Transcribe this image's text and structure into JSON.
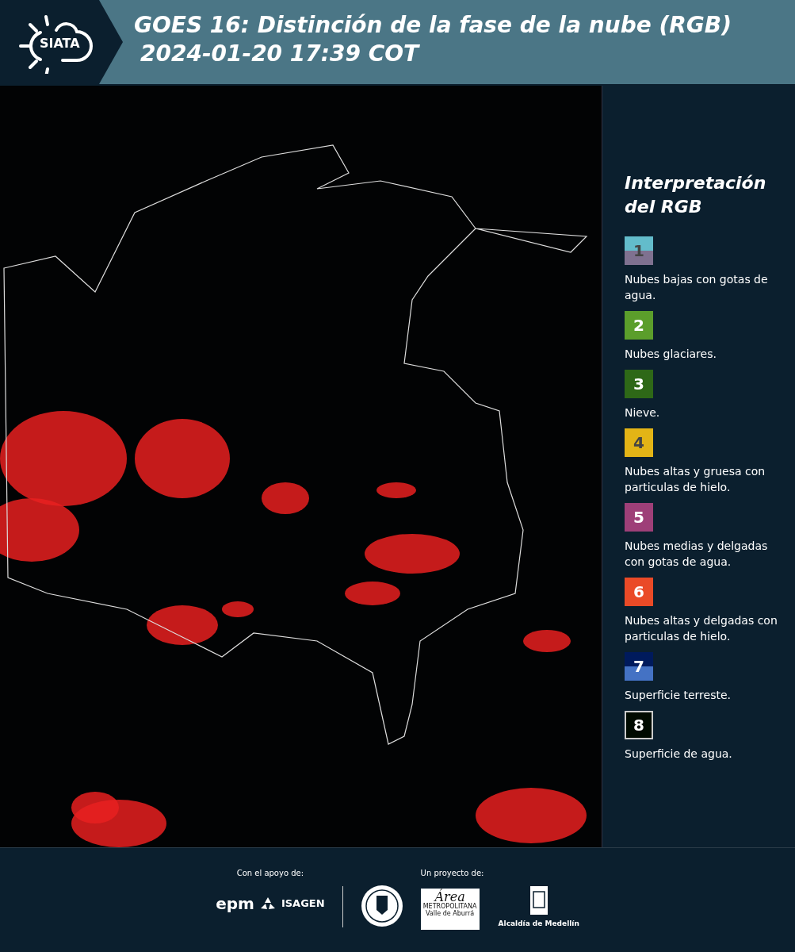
{
  "header": {
    "logo_text": "SIATA",
    "title": "GOES 16: Distinción de la fase de la nube (RGB)",
    "subtitle": "2024-01-20 17:39 COT"
  },
  "legend": {
    "title": "Interpretación del RGB",
    "items": [
      {
        "number": "1",
        "bands": [
          {
            "color": "#63bccb"
          },
          {
            "color": "#7f7190"
          }
        ],
        "label": "Nubes bajas con gotas de agua."
      },
      {
        "number": "2",
        "bands": [
          {
            "color": "#5b9e2b"
          }
        ],
        "label": "Nubes glaciares."
      },
      {
        "number": "3",
        "bands": [
          {
            "color": "#2e6817"
          }
        ],
        "label": "Nieve."
      },
      {
        "number": "4",
        "bands": [
          {
            "color": "#e3b416"
          }
        ],
        "label": "Nubes altas y gruesa con particulas de hielo."
      },
      {
        "number": "5",
        "bands": [
          {
            "color": "#9e3f78"
          }
        ],
        "label": "Nubes medias y delgadas con gotas de agua."
      },
      {
        "number": "6",
        "bands": [
          {
            "color": "#ea4a27"
          }
        ],
        "label": "Nubes altas y delgadas con particulas de hielo."
      },
      {
        "number": "7",
        "bands": [
          {
            "color": "#001a5c"
          },
          {
            "color": "#4472c4"
          }
        ],
        "label": "Superficie terreste."
      },
      {
        "number": "8",
        "bands": [
          {
            "color": "#000a00"
          }
        ],
        "label": "Superficie de agua."
      }
    ]
  },
  "footer": {
    "support_label": "Con el apoyo de:",
    "support_logos": [
      "epm",
      "ISAGEN"
    ],
    "project_label": "Un proyecto de:",
    "area_logo": {
      "title": "Área",
      "line1": "METROPOLITANA",
      "line2": "Valle de Aburrá"
    },
    "city_logo_text": "Alcaldía de Medellín"
  }
}
